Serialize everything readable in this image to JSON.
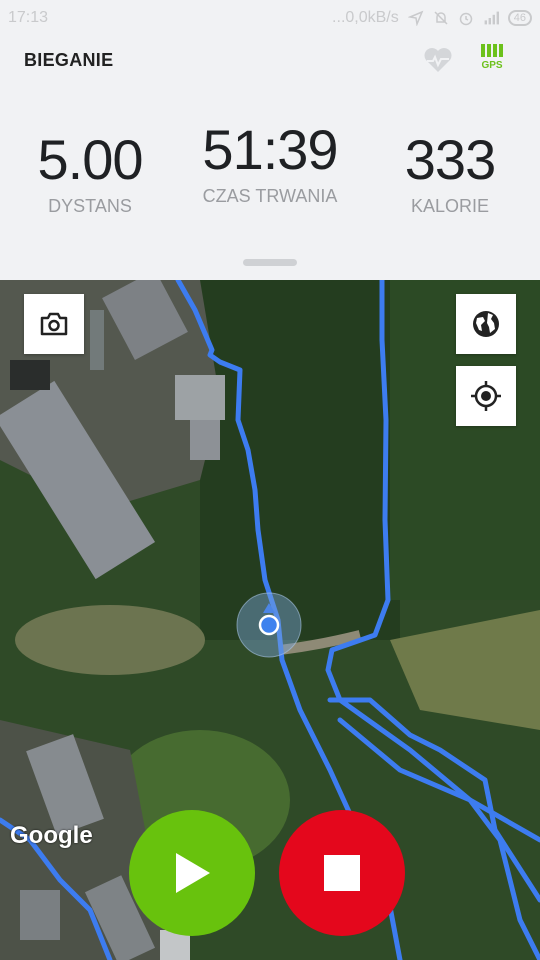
{
  "status_bar": {
    "time": "17:13",
    "network_speed": "...0,0kB/s",
    "battery": "46"
  },
  "header": {
    "title": "BIEGANIE",
    "gps_label": "GPS"
  },
  "stats": {
    "distance": {
      "value": "5.00",
      "label": "DYSTANS"
    },
    "duration": {
      "value": "51:39",
      "label": "CZAS TRWANIA"
    },
    "calories": {
      "value": "333",
      "label": "KALORIE"
    }
  },
  "map": {
    "attribution": "Google"
  },
  "icons": {
    "heart": "heart-icon",
    "gps": "gps-signal-icon",
    "camera": "camera-icon",
    "globe": "globe-icon",
    "locate": "crosshair-icon",
    "play": "play-icon",
    "stop": "stop-icon"
  },
  "colors": {
    "accent_green": "#68c20d",
    "stop_red": "#e4071c",
    "route_blue": "#3d7cf0"
  }
}
